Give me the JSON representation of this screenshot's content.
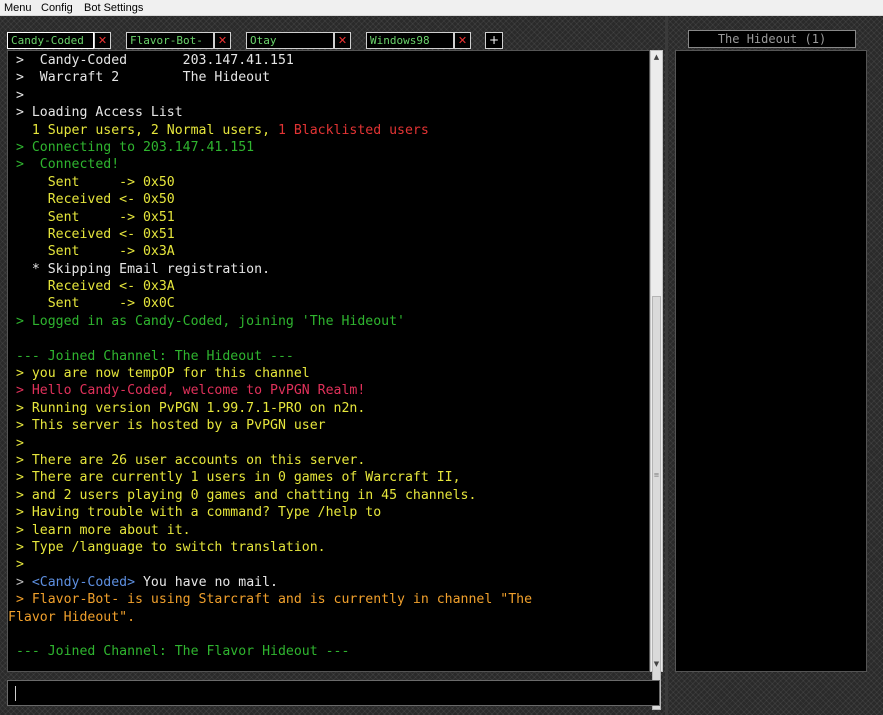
{
  "menu": {
    "items": [
      "Menu",
      "Config",
      "Bot Settings"
    ]
  },
  "tabs": [
    {
      "label": "Candy-Coded",
      "close": "✕"
    },
    {
      "label": "Flavor-Bot-",
      "close": "✕"
    },
    {
      "label": "Otay",
      "close": "✕"
    },
    {
      "label": "Windows98",
      "close": "✕"
    }
  ],
  "add_tab": "+",
  "channel_tab": {
    "label": "The Hideout (1)"
  },
  "scrollbar": {
    "up": "▲",
    "down": "▼",
    "grip": "≡"
  },
  "colors": {
    "background": "#000000",
    "green": "#2fb52f",
    "yellow": "#e6e63c",
    "orange": "#f0a02c",
    "red": "#e23434",
    "blue": "#5d8fe0",
    "tab_text": "#6bd36b"
  },
  "chat": {
    "lines": [
      [
        [
          "c-white",
          " >  Candy-Coded       203.147.41.151"
        ]
      ],
      [
        [
          "c-white",
          " >  Warcraft 2        The Hideout"
        ]
      ],
      [
        [
          "c-white",
          " >"
        ]
      ],
      [
        [
          "c-white",
          " > Loading Access List"
        ]
      ],
      [
        [
          "c-yellow",
          "   1 Super users, 2 Normal users, "
        ],
        [
          "c-red",
          "1 Blacklisted users"
        ]
      ],
      [
        [
          "c-green",
          " > Connecting to 203.147.41.151"
        ]
      ],
      [
        [
          "c-green",
          " >  Connected!"
        ]
      ],
      [
        [
          "c-yellow",
          "     Sent     -> 0x50"
        ]
      ],
      [
        [
          "c-yellow",
          "     Received <- 0x50"
        ]
      ],
      [
        [
          "c-yellow",
          "     Sent     -> 0x51"
        ]
      ],
      [
        [
          "c-yellow",
          "     Received <- 0x51"
        ]
      ],
      [
        [
          "c-yellow",
          "     Sent     -> 0x3A"
        ]
      ],
      [
        [
          "c-white",
          "   * Skipping Email registration."
        ]
      ],
      [
        [
          "c-yellow",
          "     Received <- 0x3A"
        ]
      ],
      [
        [
          "c-yellow",
          "     Sent     -> 0x0C"
        ]
      ],
      [
        [
          "c-green",
          " > Logged in as Candy-Coded, joining 'The Hideout'"
        ]
      ],
      [
        [
          "c-white",
          ""
        ]
      ],
      [
        [
          "c-green",
          " --- Joined Channel: The Hideout ---"
        ]
      ],
      [
        [
          "c-yellow",
          " > you are now tempOP for this channel"
        ]
      ],
      [
        [
          "c-pink",
          " > Hello Candy-Coded, welcome to PvPGN Realm!"
        ]
      ],
      [
        [
          "c-yellow",
          " > Running version PvPGN 1.99.7.1-PRO on n2n."
        ]
      ],
      [
        [
          "c-yellow",
          " > This server is hosted by a PvPGN user"
        ]
      ],
      [
        [
          "c-yellow",
          " >"
        ]
      ],
      [
        [
          "c-yellow",
          " > There are 26 user accounts on this server."
        ]
      ],
      [
        [
          "c-yellow",
          " > There are currently 1 users in 0 games of Warcraft II,"
        ]
      ],
      [
        [
          "c-yellow",
          " > and 2 users playing 0 games and chatting in 45 channels."
        ]
      ],
      [
        [
          "c-yellow",
          " > Having trouble with a command? Type /help to"
        ]
      ],
      [
        [
          "c-yellow",
          " > learn more about it."
        ]
      ],
      [
        [
          "c-yellow",
          " > Type /language to switch translation."
        ]
      ],
      [
        [
          "c-yellow",
          " >"
        ]
      ],
      [
        [
          "c-gray",
          " > "
        ],
        [
          "c-blue",
          "<Candy-Coded>"
        ],
        [
          "c-white",
          " You have no mail."
        ]
      ],
      [
        [
          "c-orange",
          " > Flavor-Bot- is using Starcraft and is currently in channel \"The"
        ]
      ],
      [
        [
          "c-orange",
          "Flavor Hideout\"."
        ]
      ],
      [
        [
          "c-white",
          ""
        ]
      ],
      [
        [
          "c-green",
          " --- Joined Channel: The Flavor Hideout ---"
        ]
      ]
    ]
  }
}
